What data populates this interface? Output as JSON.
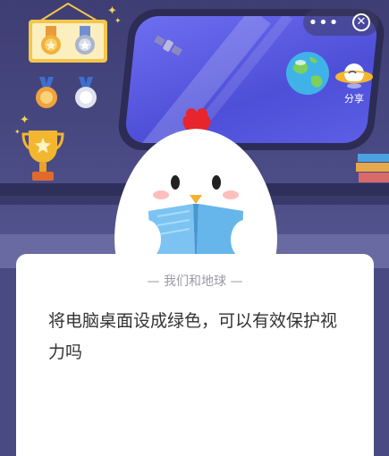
{
  "toolbar": {
    "more_label": "•••",
    "close_label": "✕",
    "share_label": "分享"
  },
  "card": {
    "header": "— 我们和地球 —",
    "question": "将电脑桌面设成绿色，可以有效保护视力吗"
  },
  "icons": {
    "more": "more-dots-icon",
    "close": "close-icon",
    "share": "share-planet-icon"
  },
  "colors": {
    "background": "#4a4a82",
    "card": "#ffffff",
    "window_glass": "#5c5ee6",
    "gold": "#f3c64a",
    "chick_comb": "#e8242c",
    "book": "#66b6ec"
  }
}
